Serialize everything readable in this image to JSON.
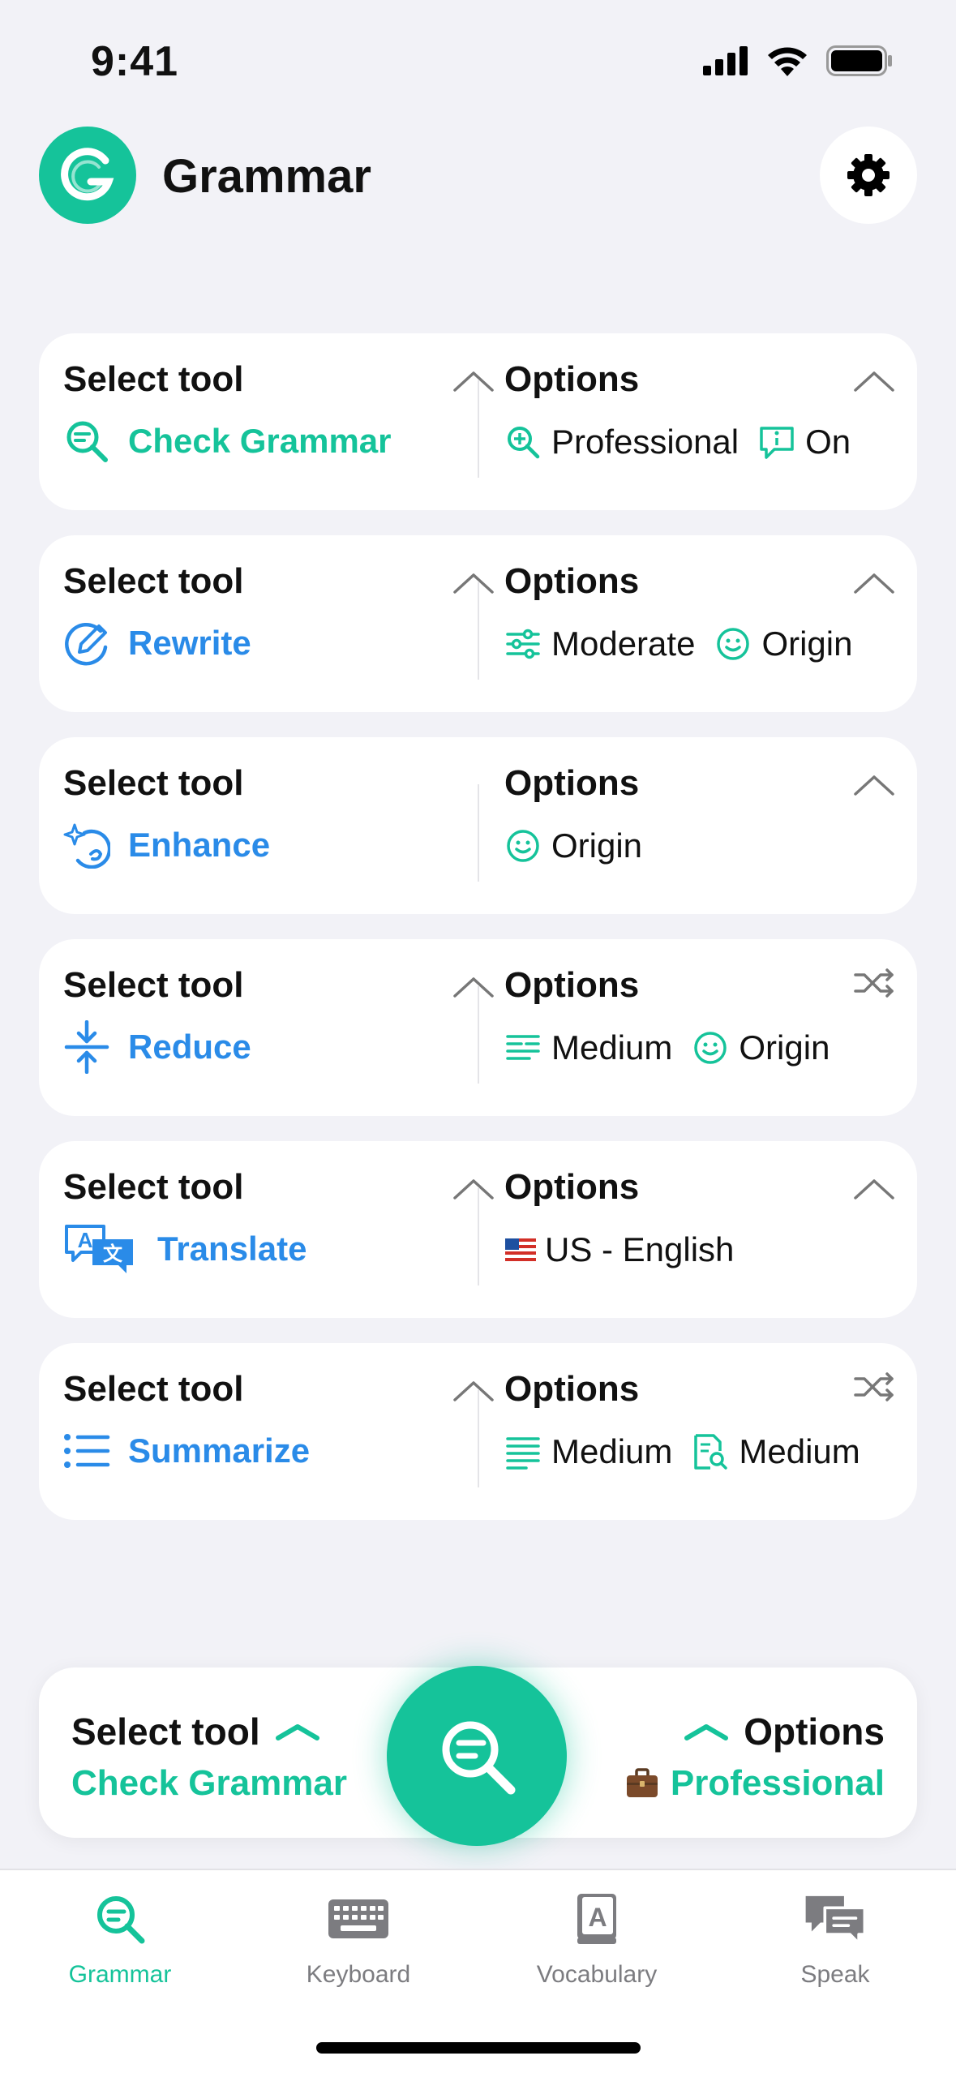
{
  "status_bar": {
    "time": "9:41"
  },
  "header": {
    "title": "Grammar",
    "logo_letter": "G"
  },
  "colors": {
    "brand": "#15C39A",
    "tool_blue": "#2A8BE8",
    "background": "#F2F2F7"
  },
  "tool_cards": [
    {
      "select_label": "Select tool",
      "tool_name": "Check Grammar",
      "tool_icon": "search-lines-icon",
      "tool_color": "#15C39A",
      "options_label": "Options",
      "options_action": "chevron-up-icon",
      "options": [
        {
          "icon": "zoom-plus-icon",
          "text": "Professional"
        },
        {
          "icon": "info-bubble-icon",
          "text": "On"
        }
      ]
    },
    {
      "select_label": "Select tool",
      "tool_name": "Rewrite",
      "tool_icon": "rewrite-pen-icon",
      "tool_color": "#2A8BE8",
      "options_label": "Options",
      "options_action": "chevron-up-icon",
      "options": [
        {
          "icon": "sliders-icon",
          "text": "Moderate"
        },
        {
          "icon": "smiley-icon",
          "text": "Origin"
        }
      ]
    },
    {
      "select_label": "Select tool",
      "tool_name": "Enhance",
      "tool_icon": "sparkle-icon",
      "tool_color": "#2A8BE8",
      "options_label": "Options",
      "options_action": "chevron-up-icon",
      "options": [
        {
          "icon": "smiley-icon",
          "text": "Origin"
        }
      ]
    },
    {
      "select_label": "Select tool",
      "tool_name": "Reduce",
      "tool_icon": "compress-icon",
      "tool_color": "#2A8BE8",
      "options_label": "Options",
      "options_action": "shuffle-icon",
      "options": [
        {
          "icon": "text-lines-icon",
          "text": "Medium"
        },
        {
          "icon": "smiley-icon",
          "text": "Origin"
        }
      ]
    },
    {
      "select_label": "Select tool",
      "tool_name": "Translate",
      "tool_icon": "translate-icon",
      "tool_color": "#2A8BE8",
      "options_label": "Options",
      "options_action": "chevron-up-icon",
      "options": [
        {
          "icon": "us-flag-icon",
          "text": "US - English"
        }
      ]
    },
    {
      "select_label": "Select tool",
      "tool_name": "Summarize",
      "tool_icon": "list-icon",
      "tool_color": "#2A8BE8",
      "options_label": "Options",
      "options_action": "shuffle-icon",
      "options": [
        {
          "icon": "paragraph-icon",
          "text": "Medium"
        },
        {
          "icon": "document-search-icon",
          "text": "Medium"
        }
      ]
    }
  ],
  "bottom_bar": {
    "left_label": "Select tool",
    "left_value": "Check Grammar",
    "right_label": "Options",
    "right_value": "Professional"
  },
  "tabs": [
    {
      "label": "Grammar",
      "icon": "grammar-tab-icon",
      "active": true
    },
    {
      "label": "Keyboard",
      "icon": "keyboard-icon",
      "active": false
    },
    {
      "label": "Vocabulary",
      "icon": "vocabulary-book-icon",
      "active": false
    },
    {
      "label": "Speak",
      "icon": "speak-bubbles-icon",
      "active": false
    }
  ]
}
